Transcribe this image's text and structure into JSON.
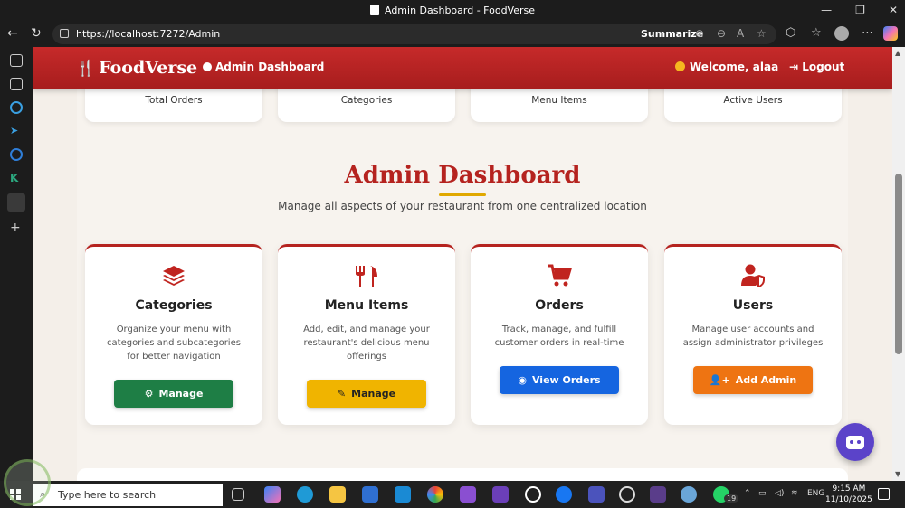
{
  "window": {
    "title": "Admin Dashboard - FoodVerse"
  },
  "browser": {
    "url": "https://localhost:7272/Admin",
    "summarize_label": "Summarize"
  },
  "navbar": {
    "brand": "FoodVerse",
    "dashboard_link": "Admin Dashboard",
    "welcome": "Welcome, alaa",
    "logout": "Logout"
  },
  "stats": [
    {
      "label": "Total Orders"
    },
    {
      "label": "Categories"
    },
    {
      "label": "Menu Items"
    },
    {
      "label": "Active Users"
    }
  ],
  "main": {
    "heading": "Admin Dashboard",
    "subtitle": "Manage all aspects of your restaurant from one centralized location"
  },
  "cards": [
    {
      "title": "Categories",
      "description": "Organize your menu with categories and subcategories for better navigation",
      "button": "Manage",
      "icon": "layers-icon",
      "button_color": "#1e7e45"
    },
    {
      "title": "Menu Items",
      "description": "Add, edit, and manage your restaurant's delicious menu offerings",
      "button": "Manage",
      "icon": "utensils-icon",
      "button_color": "#f0b400"
    },
    {
      "title": "Orders",
      "description": "Track, manage, and fulfill customer orders in real-time",
      "button": "View Orders",
      "icon": "cart-icon",
      "button_color": "#1565e0"
    },
    {
      "title": "Users",
      "description": "Manage user accounts and assign administrator privileges",
      "button": "Add Admin",
      "icon": "user-shield-icon",
      "button_color": "#ee7412"
    }
  ],
  "taskbar": {
    "search_placeholder": "Type here to search",
    "language": "ENG",
    "time": "9:15 AM",
    "date": "11/10/2025",
    "whatsapp_badge": "19"
  },
  "colors": {
    "brand_red": "#b5231f",
    "accent_gold": "#e0a800",
    "chatbot": "#5b43c9"
  }
}
